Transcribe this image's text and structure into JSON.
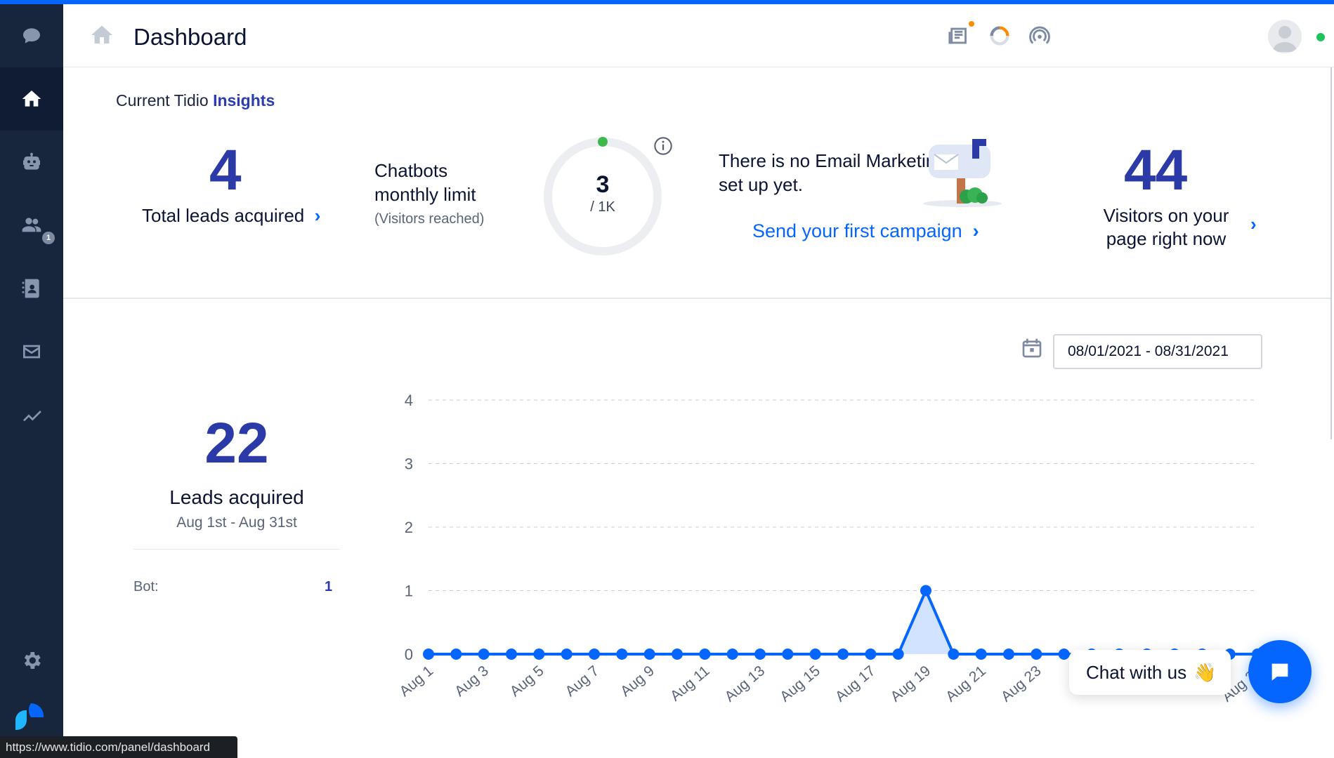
{
  "app": {
    "accent": "#0566ff",
    "sidebar_bg": "#17253d",
    "brand_blue": "#2b3aa6"
  },
  "sidebar": {
    "items": [
      {
        "icon": "chat-bubble-icon",
        "active": false
      },
      {
        "icon": "home-icon",
        "active": true
      },
      {
        "icon": "bot-icon",
        "active": false
      },
      {
        "icon": "visitors-icon",
        "active": false,
        "badge": "1"
      },
      {
        "icon": "contacts-icon",
        "active": false
      },
      {
        "icon": "email-icon",
        "active": false
      },
      {
        "icon": "analytics-icon",
        "active": false
      }
    ],
    "bottom": [
      {
        "icon": "settings-icon"
      },
      {
        "icon": "tidio-logo-icon"
      }
    ]
  },
  "header": {
    "title": "Dashboard",
    "icons": [
      "news-icon",
      "progress-icon",
      "live-visitors-icon",
      "avatar",
      "online-status"
    ]
  },
  "insights": {
    "title_prefix": "Current Tidio",
    "title_highlight": "Insights",
    "total_leads": {
      "value": "4",
      "label": "Total leads acquired"
    },
    "chatbots": {
      "label": "Chatbots monthly limit",
      "sub": "(Visitors reached)",
      "used": "3",
      "limit": "/ 1K",
      "fraction": 0.003
    },
    "email": {
      "text": "There is no Email Marketing set up yet.",
      "link": "Send your first campaign"
    },
    "visitors": {
      "value": "44",
      "label": "Visitors on your page right now"
    }
  },
  "date_range": {
    "value": "08/01/2021 - 08/31/2021"
  },
  "leads_summary": {
    "value": "22",
    "label": "Leads acquired",
    "range": "Aug 1st - Aug 31st",
    "bot_label": "Bot:",
    "bot_value": "1"
  },
  "chart_data": {
    "type": "area",
    "x": [
      "Aug 1",
      "Aug 2",
      "Aug 3",
      "Aug 4",
      "Aug 5",
      "Aug 6",
      "Aug 7",
      "Aug 8",
      "Aug 9",
      "Aug 10",
      "Aug 11",
      "Aug 12",
      "Aug 13",
      "Aug 14",
      "Aug 15",
      "Aug 16",
      "Aug 17",
      "Aug 18",
      "Aug 19",
      "Aug 20",
      "Aug 21",
      "Aug 22",
      "Aug 23",
      "Aug 24",
      "Aug 25",
      "Aug 26",
      "Aug 27",
      "Aug 28",
      "Aug 29",
      "Aug 30",
      "Aug 31"
    ],
    "x_tick_labels": [
      "Aug 1",
      "Aug 3",
      "Aug 5",
      "Aug 7",
      "Aug 9",
      "Aug 11",
      "Aug 13",
      "Aug 15",
      "Aug 17",
      "Aug 19",
      "Aug 21",
      "Aug 23",
      "Aug",
      "Aug",
      "Aug",
      "Aug 31"
    ],
    "values": [
      0,
      0,
      0,
      0,
      0,
      0,
      0,
      0,
      0,
      0,
      0,
      0,
      0,
      0,
      0,
      0,
      0,
      0,
      1,
      0,
      0,
      0,
      0,
      0,
      0,
      0,
      0,
      0,
      0,
      0,
      0
    ],
    "ylim": [
      0,
      4
    ],
    "y_ticks": [
      0,
      1,
      2,
      3,
      4
    ],
    "grid": true,
    "color": "#0566ff"
  },
  "chat_widget": {
    "label": "Chat with us",
    "emoji": "👋"
  },
  "status_bar": {
    "url": "https://www.tidio.com/panel/dashboard"
  }
}
